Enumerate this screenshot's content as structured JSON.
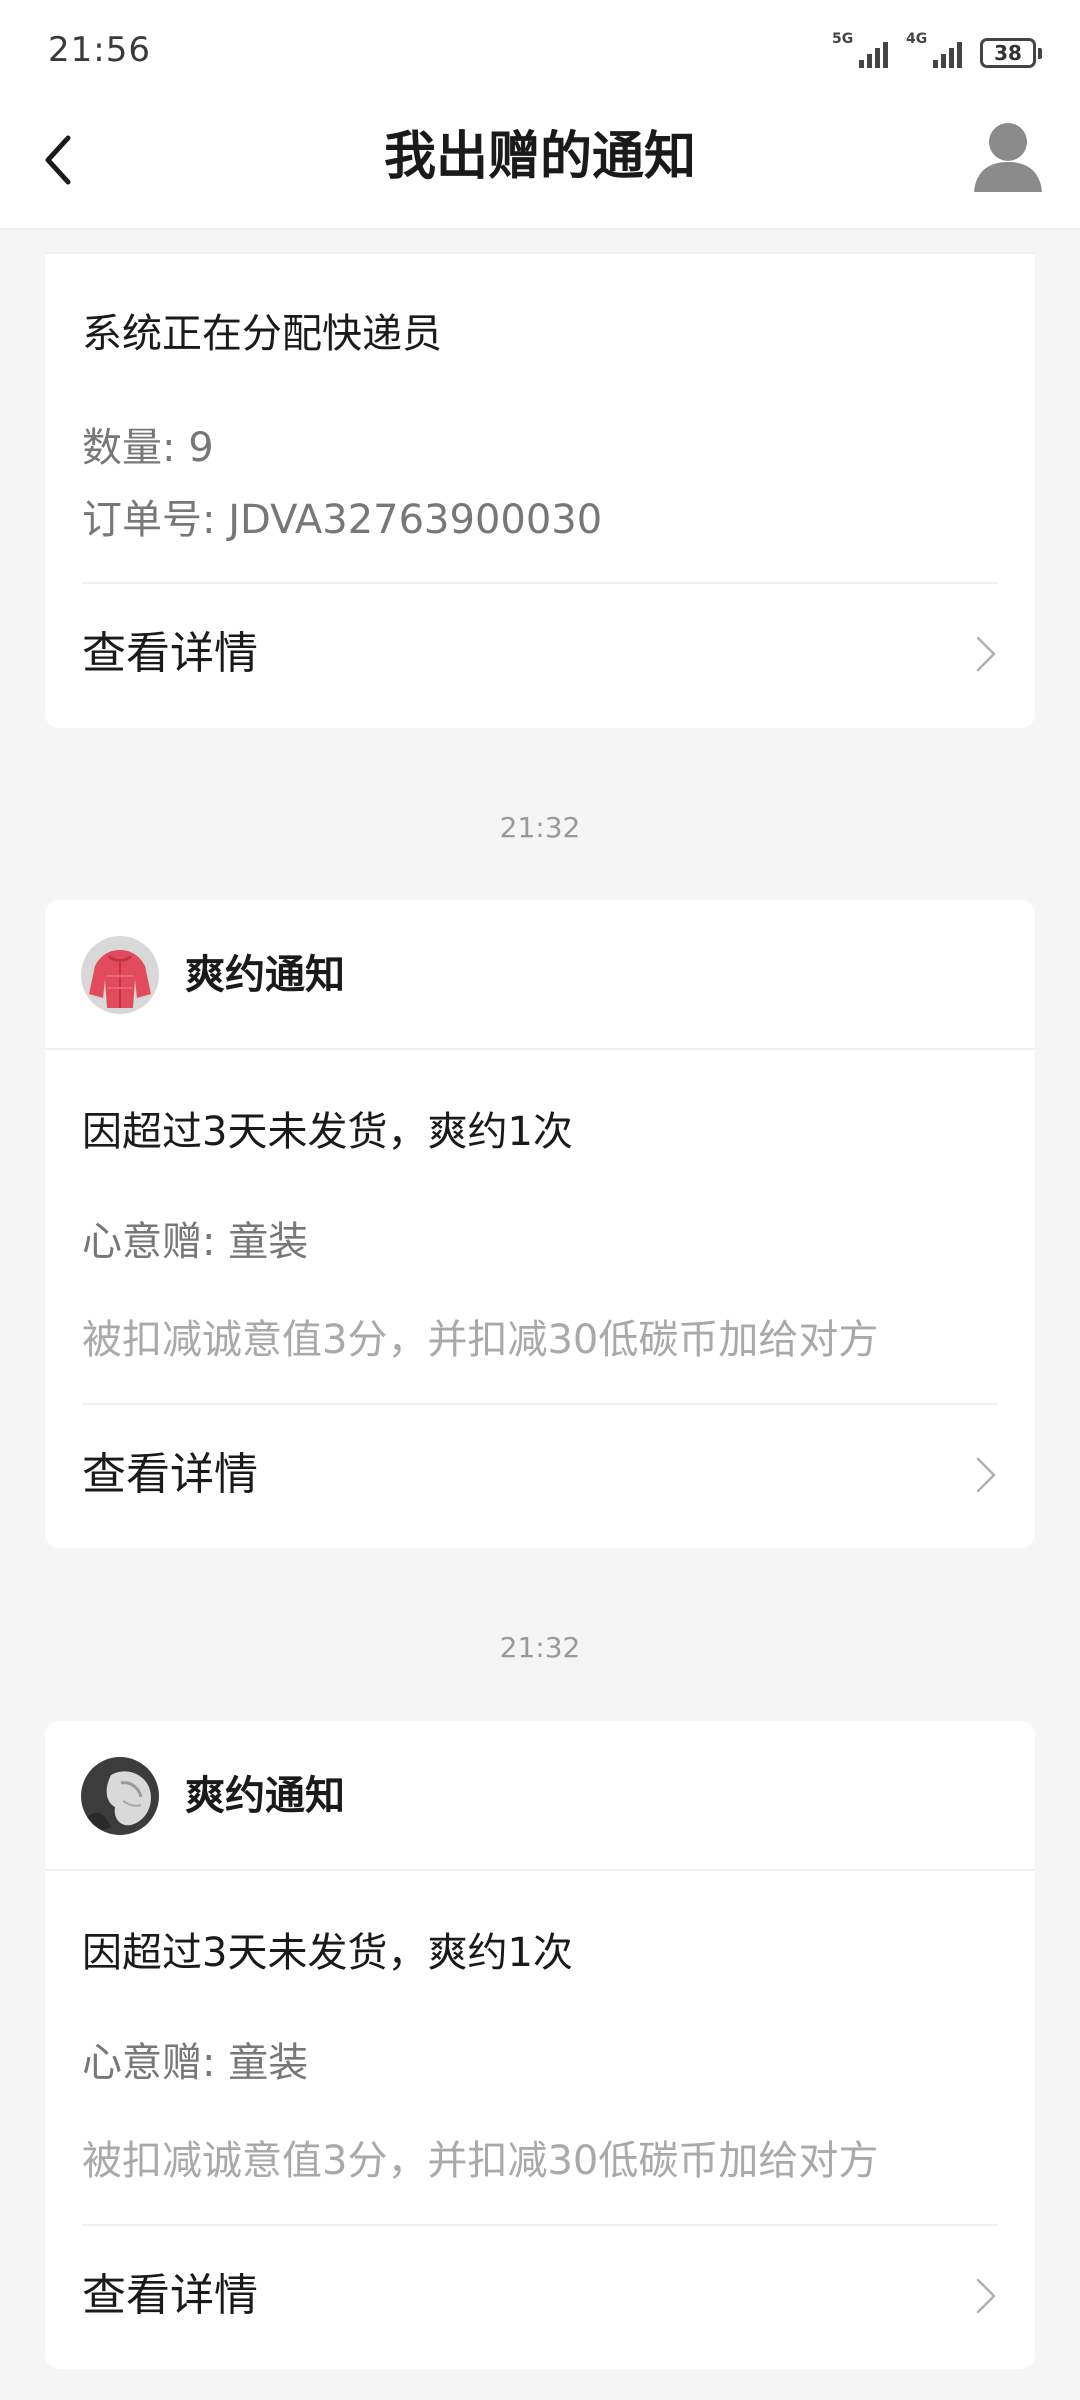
{
  "status_bar": {
    "time": "21:56",
    "network_1": "5G",
    "network_2": "4G",
    "battery": "38"
  },
  "header": {
    "title": "我出赠的通知",
    "back_icon": "back-arrow-icon",
    "profile_icon": "user-profile-icon"
  },
  "notifications": [
    {
      "message": "系统正在分配快递员",
      "quantity": "数量: 9",
      "order_no": "订单号: JDVA32763900030",
      "detail_label": "查看详情"
    },
    {
      "timestamp": "21:32",
      "title": "爽约通知",
      "avatar": "red-jacket-photo",
      "message": "因超过3天未发货，爽约1次",
      "item": "心意赠: 童装",
      "note": "被扣减诚意值3分，并扣减30低碳币加给对方",
      "detail_label": "查看详情"
    },
    {
      "timestamp": "21:32",
      "title": "爽约通知",
      "avatar": "gray-clothing-photo",
      "message": "因超过3天未发货，爽约1次",
      "item": "心意赠: 童装",
      "note": "被扣减诚意值3分，并扣减30低碳币加给对方",
      "detail_label": "查看详情"
    }
  ]
}
